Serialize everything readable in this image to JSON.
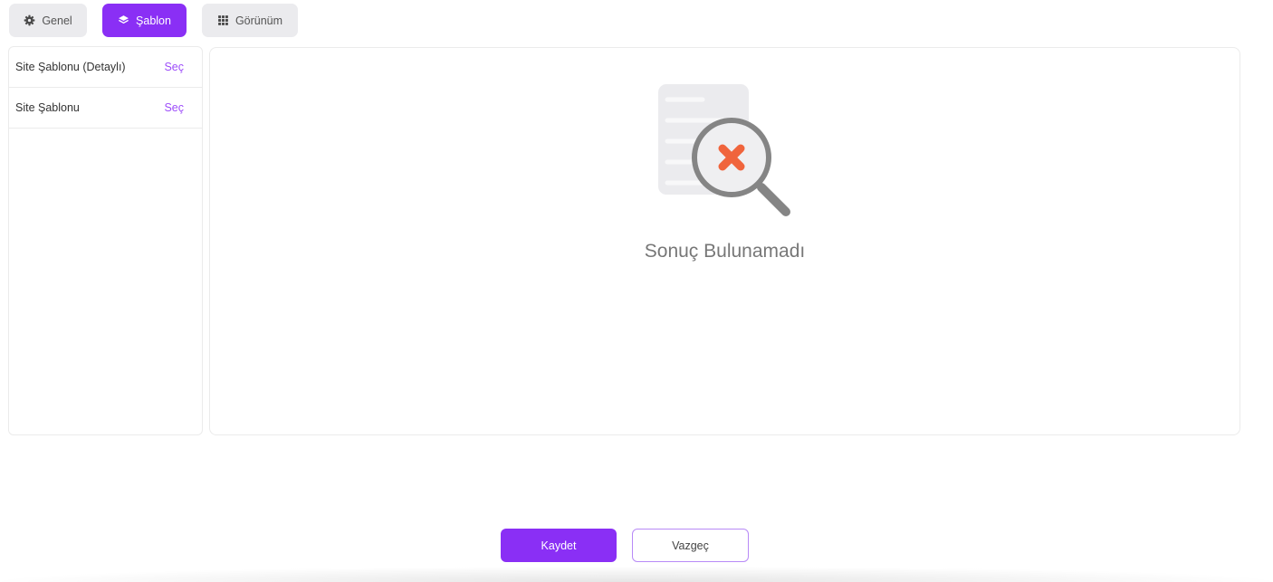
{
  "tabs": [
    {
      "label": "Genel",
      "icon": "gear-icon",
      "active": false
    },
    {
      "label": "Şablon",
      "icon": "layers-icon",
      "active": true
    },
    {
      "label": "Görünüm",
      "icon": "grid-icon",
      "active": false
    }
  ],
  "template_list": {
    "items": [
      {
        "label": "Site Şablonu (Detaylı)",
        "action": "Seç"
      },
      {
        "label": "Site Şablonu",
        "action": "Seç"
      }
    ]
  },
  "empty_state": {
    "icon": "document-search-x-icon",
    "message": "Sonuç Bulunamadı"
  },
  "footer": {
    "save_label": "Kaydet",
    "cancel_label": "Vazgeç"
  },
  "colors": {
    "accent": "#8a2ff5",
    "accent_soft": "#b88af7",
    "link": "#9d4dfa",
    "danger": "#f0643c",
    "muted_icon": "#858585"
  }
}
